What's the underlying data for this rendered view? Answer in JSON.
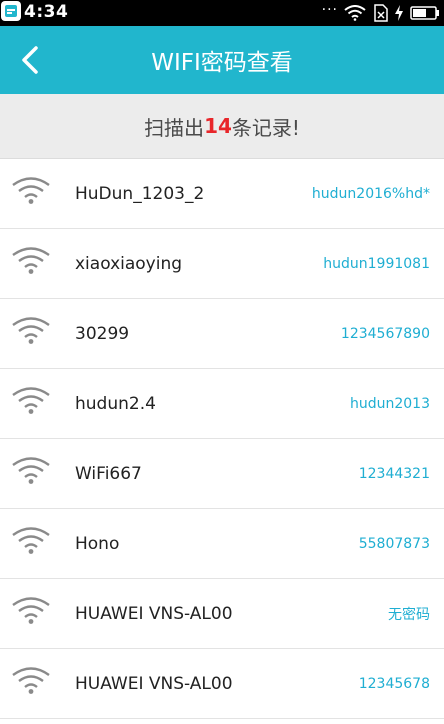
{
  "status_bar": {
    "time": "4:34",
    "dots": "···"
  },
  "app_bar": {
    "title": "WIFI密码查看"
  },
  "summary": {
    "prefix": "扫描出",
    "count": "14",
    "suffix": "条记录!"
  },
  "colors": {
    "accent": "#21b6cd",
    "password_text": "#1faed2",
    "count_highlight": "#e8262a"
  },
  "wifi_list": [
    {
      "name": "HuDun_1203_2",
      "password": "hudun2016%hd*"
    },
    {
      "name": "xiaoxiaoying",
      "password": "hudun1991081"
    },
    {
      "name": "30299",
      "password": "1234567890"
    },
    {
      "name": "hudun2.4",
      "password": "hudun2013"
    },
    {
      "name": "WiFi667",
      "password": "12344321"
    },
    {
      "name": "Hono",
      "password": "55807873"
    },
    {
      "name": "HUAWEI VNS-AL00",
      "password": "无密码"
    },
    {
      "name": "HUAWEI VNS-AL00",
      "password": "12345678"
    }
  ]
}
